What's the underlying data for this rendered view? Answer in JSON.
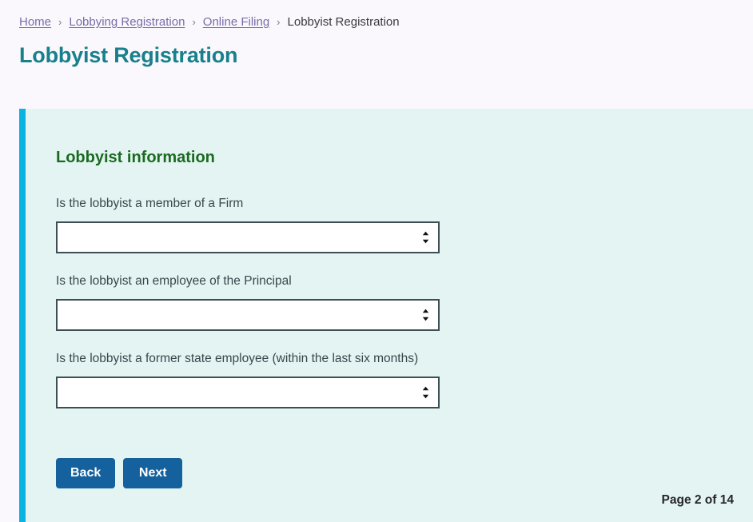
{
  "breadcrumb": {
    "separator": "›",
    "items": [
      {
        "label": "Home",
        "is_link": true
      },
      {
        "label": "Lobbying Registration",
        "is_link": true
      },
      {
        "label": "Online Filing",
        "is_link": true
      },
      {
        "label": "Lobbyist Registration",
        "is_link": false
      }
    ]
  },
  "header": {
    "title": "Lobbyist Registration"
  },
  "panel": {
    "section_heading": "Lobbyist information",
    "fields": [
      {
        "label": "Is the lobbyist a member of a Firm",
        "value": "",
        "options": [
          ""
        ]
      },
      {
        "label": "Is the lobbyist an employee of the Principal",
        "value": "",
        "options": [
          ""
        ]
      },
      {
        "label": "Is the lobbyist a former state employee (within the last six months)",
        "value": "",
        "options": [
          ""
        ]
      }
    ],
    "buttons": {
      "back_label": "Back",
      "next_label": "Next"
    },
    "page_counter": "Page 2 of 14"
  },
  "colors": {
    "page_background": "#faf8fd",
    "panel_background": "#e3f4f3",
    "panel_accent_border": "#0bb4e0",
    "title_teal": "#18808c",
    "section_heading_green": "#1a6b20",
    "link_purple": "#7a6ca8",
    "button_blue": "#14619e",
    "select_border": "#3d4f54"
  },
  "icons": {
    "breadcrumb_separator": "chevron-right-icon",
    "select_indicator": "chevron-up-down-icon"
  }
}
